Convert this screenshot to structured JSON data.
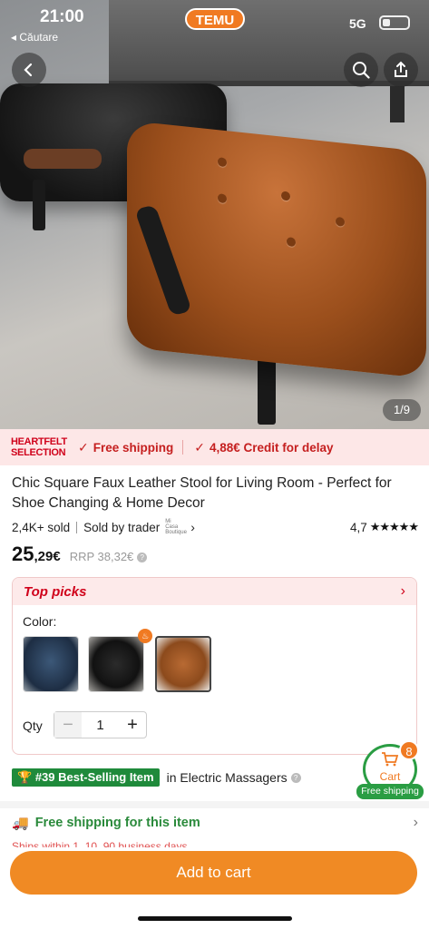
{
  "status_bar": {
    "time": "21:00",
    "back_app": "◂ Căutare",
    "network": "5G"
  },
  "header": {
    "logo": "TEMU"
  },
  "icons": {
    "back": "chevron-left-icon",
    "search": "search-icon",
    "share": "share-icon"
  },
  "gallery": {
    "counter": "1/9"
  },
  "promo": {
    "logo_line1": "HEARTFELT",
    "logo_line2": "SELECTION",
    "item1": "Free shipping",
    "item2": "4,88€ Credit for delay"
  },
  "product": {
    "title": "Chic Square Faux Leather Stool for Living Room - Perfect for Shoe Changing & Home Decor",
    "sold": "2,4K+ sold",
    "sold_by": "Sold by trader",
    "trader_logo_text": "Mi Casa Boutique",
    "rating": "4,7",
    "stars": "★★★★★",
    "price_int": "25",
    "price_dec": ",29€",
    "rrp": "RRP 38,32€"
  },
  "picks": {
    "title": "Top picks",
    "color_label": "Color:",
    "swatches": [
      "navy-blue-stool",
      "black-stool",
      "brown-stool"
    ],
    "selected_index": 2,
    "qty_label": "Qty",
    "qty_value": "1"
  },
  "best_selling": {
    "badge": "#39 Best-Selling Item",
    "category": "in Electric Massagers"
  },
  "cart": {
    "label": "Cart",
    "count": "8",
    "shipping": "Free shipping"
  },
  "shipping": {
    "label": "Free shipping for this item",
    "sub": "Ships within 1, 10, 90 business days"
  },
  "cta": {
    "add_to_cart": "Add to cart"
  },
  "colors": {
    "accent": "#f07a22",
    "promo_red": "#c51f1f",
    "green": "#2a9d43"
  }
}
